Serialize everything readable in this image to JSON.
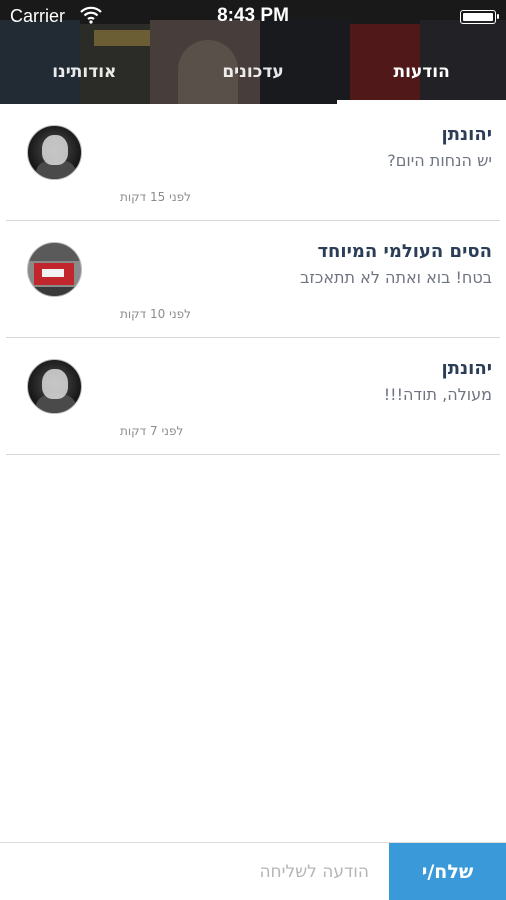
{
  "status_bar": {
    "carrier": "Carrier",
    "time": "8:43 PM",
    "wifi_icon": "wifi-icon",
    "battery_icon": "battery-icon"
  },
  "tabs": [
    {
      "label": "הודעות",
      "active": true
    },
    {
      "label": "עדכונים",
      "active": false
    },
    {
      "label": "אודותינו",
      "active": false
    }
  ],
  "messages": [
    {
      "sender": "יהונתן",
      "text": "יש הנחות היום?",
      "time": "לפני 15 דקות",
      "avatar": "person-avatar"
    },
    {
      "sender": "הסים העולמי המיוחד",
      "text": "בטח! בוא ואתה לא תתאכזב",
      "time": "לפני 10 דקות",
      "avatar": "store-avatar"
    },
    {
      "sender": "יהונתן",
      "text": "מעולה, תודה!!!",
      "time": "לפני 7 דקות",
      "avatar": "person-avatar"
    }
  ],
  "composer": {
    "placeholder": "הודעה לשליחה",
    "value": "",
    "send_label": "שלח/י"
  },
  "colors": {
    "send_button": "#3a9ad9",
    "sender_name": "#2c3e57",
    "message_text": "#6e7480",
    "tab_indicator": "#ffffff"
  }
}
